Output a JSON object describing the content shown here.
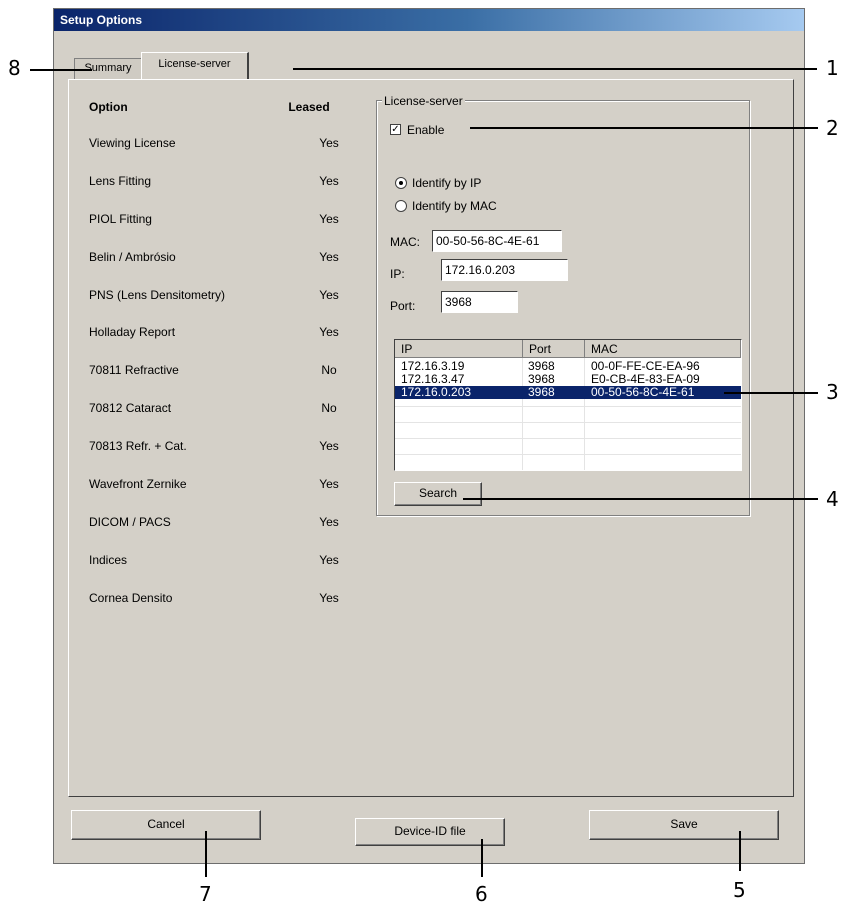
{
  "window": {
    "title": "Setup Options"
  },
  "tabs": [
    {
      "label": "Summary"
    },
    {
      "label": "License-server"
    }
  ],
  "options": {
    "header_option": "Option",
    "header_leased": "Leased",
    "rows": [
      {
        "name": "Viewing License",
        "leased": "Yes"
      },
      {
        "name": "Lens Fitting",
        "leased": "Yes"
      },
      {
        "name": "PIOL Fitting",
        "leased": "Yes"
      },
      {
        "name": "Belin / Ambrósio",
        "leased": "Yes"
      },
      {
        "name": "PNS (Lens Densitometry)",
        "leased": "Yes"
      },
      {
        "name": "Holladay Report",
        "leased": "Yes"
      },
      {
        "name": "70811 Refractive",
        "leased": "No"
      },
      {
        "name": "70812 Cataract",
        "leased": "No"
      },
      {
        "name": "70813  Refr. + Cat.",
        "leased": "Yes"
      },
      {
        "name": "Wavefront Zernike",
        "leased": "Yes"
      },
      {
        "name": "DICOM / PACS",
        "leased": "Yes"
      },
      {
        "name": "Indices",
        "leased": "Yes"
      },
      {
        "name": "Cornea Densito",
        "leased": "Yes"
      }
    ]
  },
  "license_server": {
    "group_label": "License-server",
    "enable_label": "Enable",
    "enable_checked": true,
    "identify_ip_label": "Identify by IP",
    "identify_mac_label": "Identify by MAC",
    "identify_selected": "ip",
    "mac_label": "MAC:",
    "mac_value": "00-50-56-8C-4E-61",
    "ip_label": "IP:",
    "ip_value": "172.16.0.203",
    "port_label": "Port:",
    "port_value": "3968",
    "list_headers": [
      "IP",
      "Port",
      "MAC"
    ],
    "list_rows": [
      {
        "ip": "172.16.3.19",
        "port": "3968",
        "mac": "00-0F-FE-CE-EA-96",
        "selected": false
      },
      {
        "ip": "172.16.3.47",
        "port": "3968",
        "mac": "E0-CB-4E-83-EA-09",
        "selected": false
      },
      {
        "ip": "172.16.0.203",
        "port": "3968",
        "mac": "00-50-56-8C-4E-61",
        "selected": true
      }
    ],
    "search_label": "Search"
  },
  "buttons": {
    "cancel": "Cancel",
    "device_id": "Device-ID file",
    "save": "Save"
  },
  "callouts": [
    "1",
    "2",
    "3",
    "4",
    "5",
    "6",
    "7",
    "8"
  ],
  "colors": {
    "dialog_bg": "#d4d0c8",
    "title_start": "#0a246a",
    "selection": "#0a246a"
  }
}
